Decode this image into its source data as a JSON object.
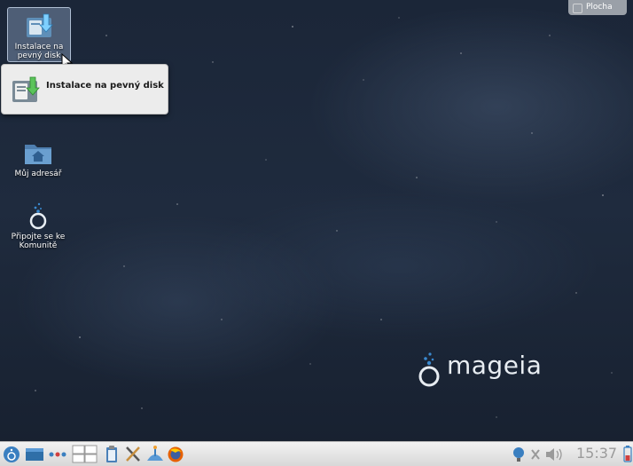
{
  "desktop": {
    "icons": [
      {
        "label": "Instalace na pevný disk",
        "icon": "install-disk-icon"
      },
      {
        "label": "Můj adresář",
        "icon": "home-folder-icon"
      },
      {
        "label": "Připojte se ke Komunitě",
        "icon": "mageia-community-icon"
      }
    ],
    "tooltip": {
      "text": "Instalace na pevný disk",
      "icon": "install-disk-icon"
    },
    "plocha_label": "Plocha",
    "brand": "mageia"
  },
  "taskbar": {
    "clock": "15:37",
    "items": [
      "mageia-menu-icon",
      "show-desktop-icon",
      "activities-icon",
      "pager-icon",
      "clipboard-icon",
      "settings-tools-icon",
      "software-installer-icon",
      "firefox-icon"
    ],
    "tray": [
      "network-icon",
      "x-icon",
      "volume-icon",
      "battery-icon"
    ]
  },
  "colors": {
    "background": "#1f2b3e",
    "taskbar": "#e6e6e6",
    "mageia_blue": "#3a8ad0"
  }
}
